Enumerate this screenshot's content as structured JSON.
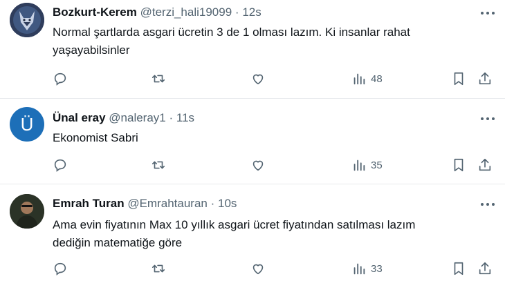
{
  "tweets": [
    {
      "name": "Bozkurt-Kerem",
      "handle": "@terzi_hali19099",
      "separator": "·",
      "time": "12s",
      "text_lines": [
        "Normal şartlarda asgari ücretin 3 de 1 olması lazım. Ki insanlar rahat",
        "yaşayabilsinler"
      ],
      "views": "48",
      "avatar": {
        "kind": "wolf-image",
        "bg": "#3b4a6b"
      }
    },
    {
      "name": "Ünal eray",
      "handle": "@naleray1",
      "separator": "·",
      "time": "11s",
      "text_lines": [
        "Ekonomist Sabri"
      ],
      "views": "35",
      "avatar": {
        "kind": "letter",
        "letter": "Ü",
        "bg": "#1d6fb8"
      }
    },
    {
      "name": "Emrah Turan",
      "handle": "@Emrahtauran",
      "separator": "·",
      "time": "10s",
      "text_lines": [
        "Ama evin fiyatının Max 10 yıllık asgari ücret fiyatından satılması lazım",
        "dediğin matematiğe göre"
      ],
      "views": "33",
      "avatar": {
        "kind": "photo",
        "bg": "#2a2f24"
      }
    }
  ],
  "icons": {
    "reply": "reply-icon",
    "retweet": "retweet-icon",
    "like": "heart-icon",
    "views": "views-bar-chart-icon",
    "bookmark": "bookmark-icon",
    "share": "share-icon",
    "more": "more-dots-icon"
  },
  "colors": {
    "text": "#0f1419",
    "muted": "#536471",
    "divider": "#e6e9ec"
  }
}
